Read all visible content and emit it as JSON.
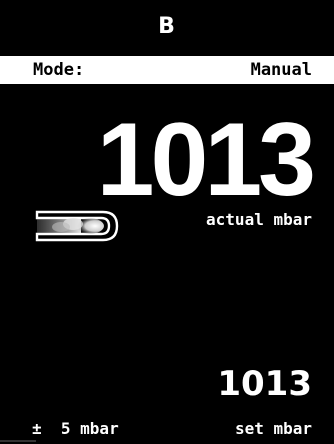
{
  "title": "B",
  "mode": {
    "label": "Mode:",
    "value": "Manual"
  },
  "actual": {
    "value": "1013",
    "unit_label": "actual mbar"
  },
  "set": {
    "value": "1013",
    "unit_label": "set mbar"
  },
  "tolerance": "±  5 mbar",
  "icons": {
    "gauge": "pressure-gauge-icon"
  },
  "colors": {
    "background": "#000000",
    "foreground": "#ffffff",
    "mode_bar_background": "#ffffff",
    "mode_bar_text": "#000000"
  }
}
